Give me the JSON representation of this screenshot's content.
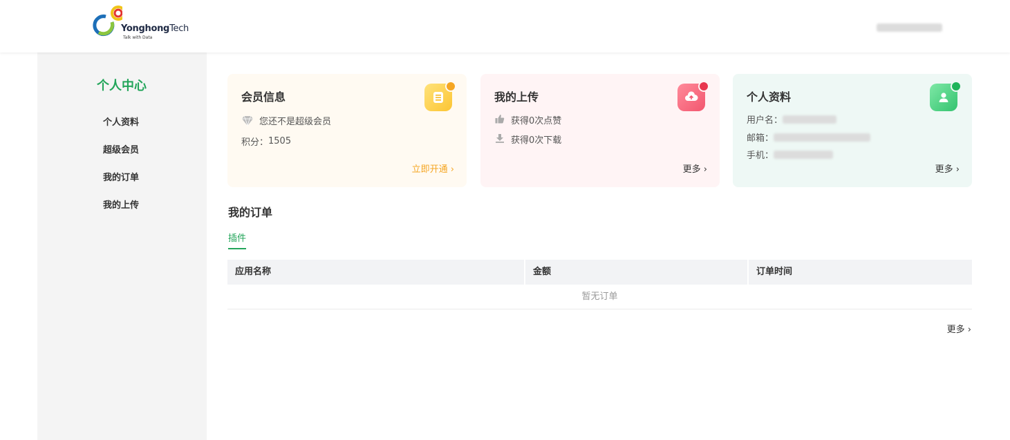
{
  "header": {
    "logo": {
      "name": "Yonghong",
      "name_suffix": "Tech",
      "tagline": "Talk with Data"
    }
  },
  "sidebar": {
    "title": "个人中心",
    "items": [
      {
        "label": "个人资料"
      },
      {
        "label": "超级会员"
      },
      {
        "label": "我的订单"
      },
      {
        "label": "我的上传"
      }
    ]
  },
  "cards": {
    "member": {
      "title": "会员信息",
      "status": "您还不是超级会员",
      "points_label": "积分：",
      "points": "1505",
      "action": "立即开通",
      "icons": [
        "diamond-icon",
        "clipboard-icon"
      ],
      "colors": {
        "bg": "#fffaf2",
        "accent": "#f5a623"
      }
    },
    "upload": {
      "title": "我的上传",
      "likes": "获得0次点赞",
      "downloads": "获得0次下载",
      "more": "更多",
      "icons": [
        "thumbs-up-icon",
        "download-icon",
        "cloud-upload-icon"
      ],
      "colors": {
        "bg": "#fff4f5",
        "accent": "#f2647a"
      }
    },
    "profile": {
      "title": "个人资料",
      "username_label": "用户名：",
      "email_label": "邮箱：",
      "phone_label": "手机：",
      "more": "更多",
      "icons": [
        "user-icon"
      ],
      "colors": {
        "bg": "#eef8f5",
        "accent": "#3ec97a"
      }
    }
  },
  "orders": {
    "title": "我的订单",
    "tab": "插件",
    "columns": [
      "应用名称",
      "金额",
      "订单时间"
    ],
    "empty_text": "暂无订单",
    "more": "更多"
  },
  "colors": {
    "brand_green": "#23a55a"
  }
}
